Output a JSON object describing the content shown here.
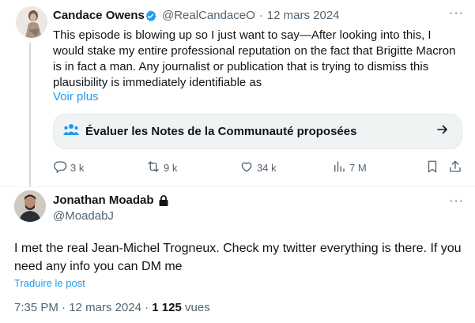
{
  "colors": {
    "accent": "#1d9bf0",
    "text": "#0f1419",
    "muted": "#536471"
  },
  "tweet1": {
    "author_name": "Candace Owens",
    "handle": "@RealCandaceO",
    "separator": "·",
    "date": "12 mars 2024",
    "text": "This episode is blowing up so I just want to say—After looking into this, I would stake my entire professional reputation on the fact that Brigitte Macron is in fact a man. Any journalist or publication that is trying to dismiss this plausibility is immediately identifiable as",
    "show_more": "Voir plus",
    "community_notes": "Évaluer les Notes de la Communauté proposées",
    "actions": {
      "replies": "3 k",
      "reposts": "9 k",
      "likes": "34 k",
      "views": "7 M"
    }
  },
  "tweet2": {
    "author_name": "Jonathan Moadab",
    "handle": "@MoadabJ",
    "text": "I met the real Jean-Michel Trogneux. Check my twitter everything is there. If you need any info you can DM me",
    "translate": "Traduire le post",
    "time": "7:35 PM",
    "separator": "·",
    "date": "12 mars 2024",
    "views_count": "1 125",
    "views_label": "vues"
  }
}
